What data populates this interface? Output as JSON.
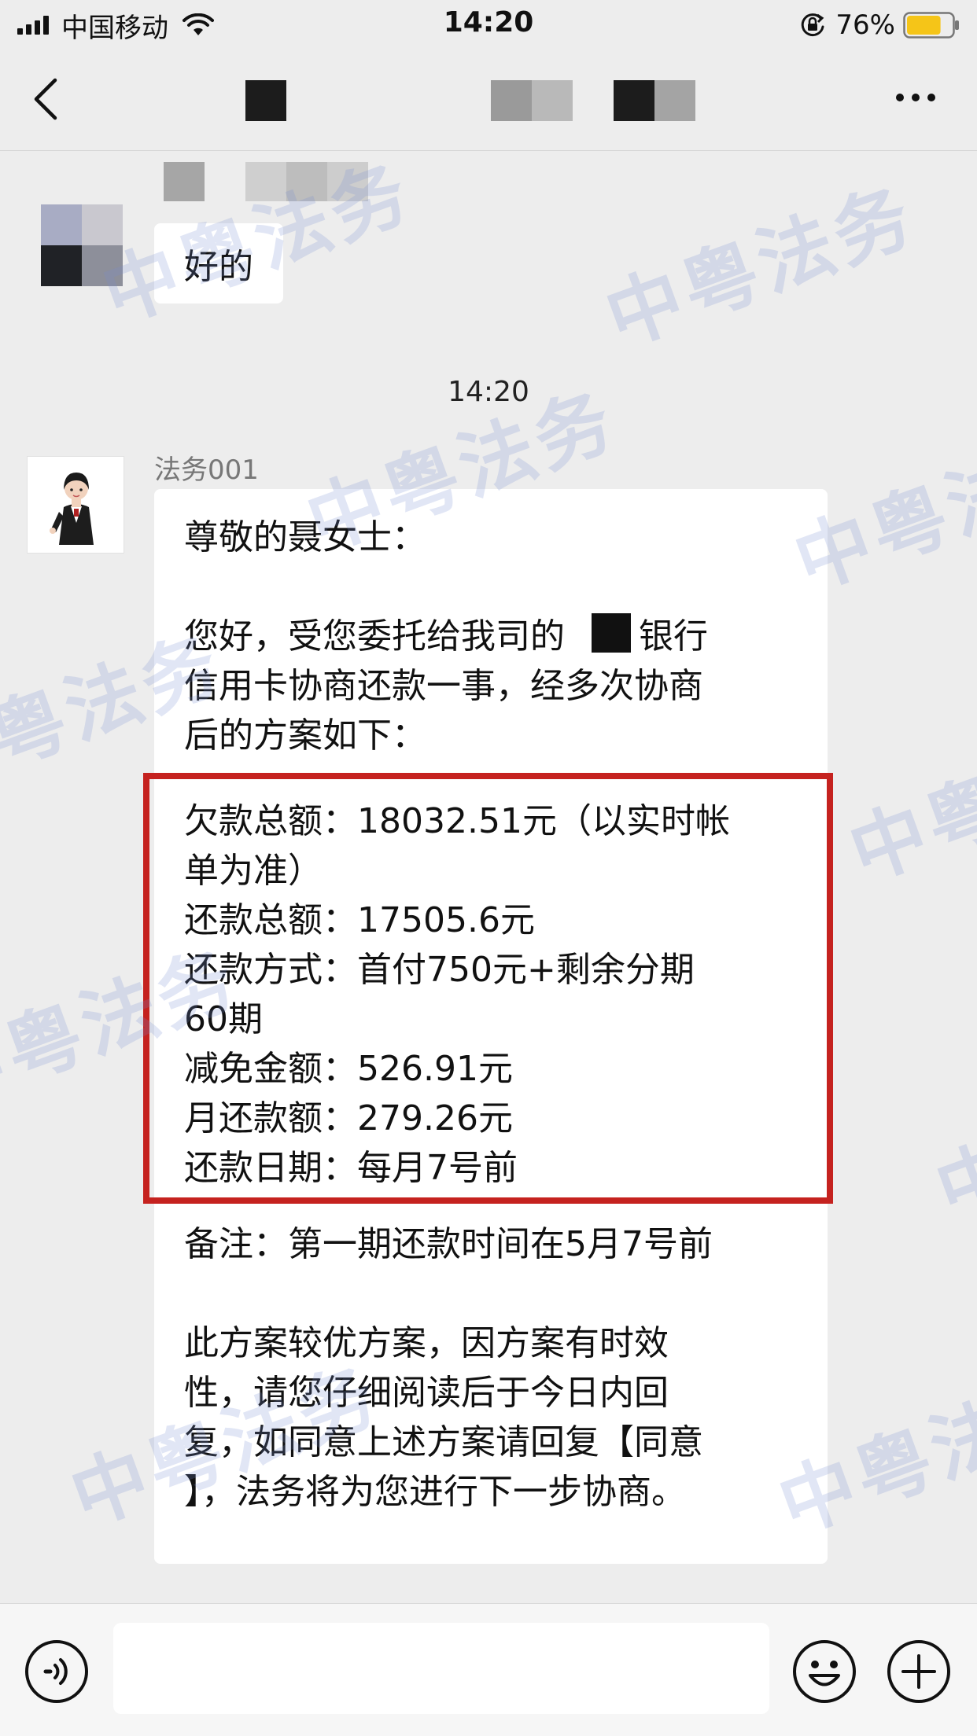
{
  "status_bar": {
    "carrier": "中国移动",
    "time": "14:20",
    "battery": "76%",
    "battery_level": 0.76
  },
  "nav": {
    "back_icon": "chevron-left-icon",
    "more_icon": "ellipsis-icon"
  },
  "chat": {
    "previous_message": {
      "text": "好的"
    },
    "time_divider": "14:20",
    "sender_name": "法务001",
    "message": {
      "greeting": "尊敬的聂女士：",
      "intro_before": "您好，受您委托给我司的",
      "intro_after": "银行",
      "intro_line2": "信用卡协商还款一事，经多次协商",
      "intro_line3": "后的方案如下：",
      "plan": [
        {
          "label": "欠款总额：",
          "value": "18032.51元（以实时帐"
        },
        {
          "label": "",
          "value": "单为准）"
        },
        {
          "label": "还款总额：",
          "value": "17505.6元"
        },
        {
          "label": "还款方式：",
          "value": "首付750元+剩余分期"
        },
        {
          "label": "",
          "value": "60期"
        },
        {
          "label": "减免金额：",
          "value": "526.91元"
        },
        {
          "label": "月还款额：",
          "value": "279.26元"
        },
        {
          "label": "还款日期：",
          "value": "每月7号前"
        }
      ],
      "note": "备注：第一期还款时间在5月7号前",
      "closing_lines": [
        "此方案较优方案，因方案有时效",
        "性，请您仔细阅读后于今日内回",
        "复，如同意上述方案请回复【同意",
        "】，法务将为您进行下一步协商。"
      ]
    },
    "watermark_text": "中粤法务"
  },
  "input_bar": {
    "placeholder": "",
    "voice_icon": "voice-icon",
    "emoji_icon": "emoji-icon",
    "plus_icon": "plus-icon"
  },
  "colors": {
    "background": "#ededed",
    "bubble": "#ffffff",
    "highlight_border": "#c5221f",
    "battery_fill": "#f5c518",
    "watermark": "#788cd2"
  }
}
